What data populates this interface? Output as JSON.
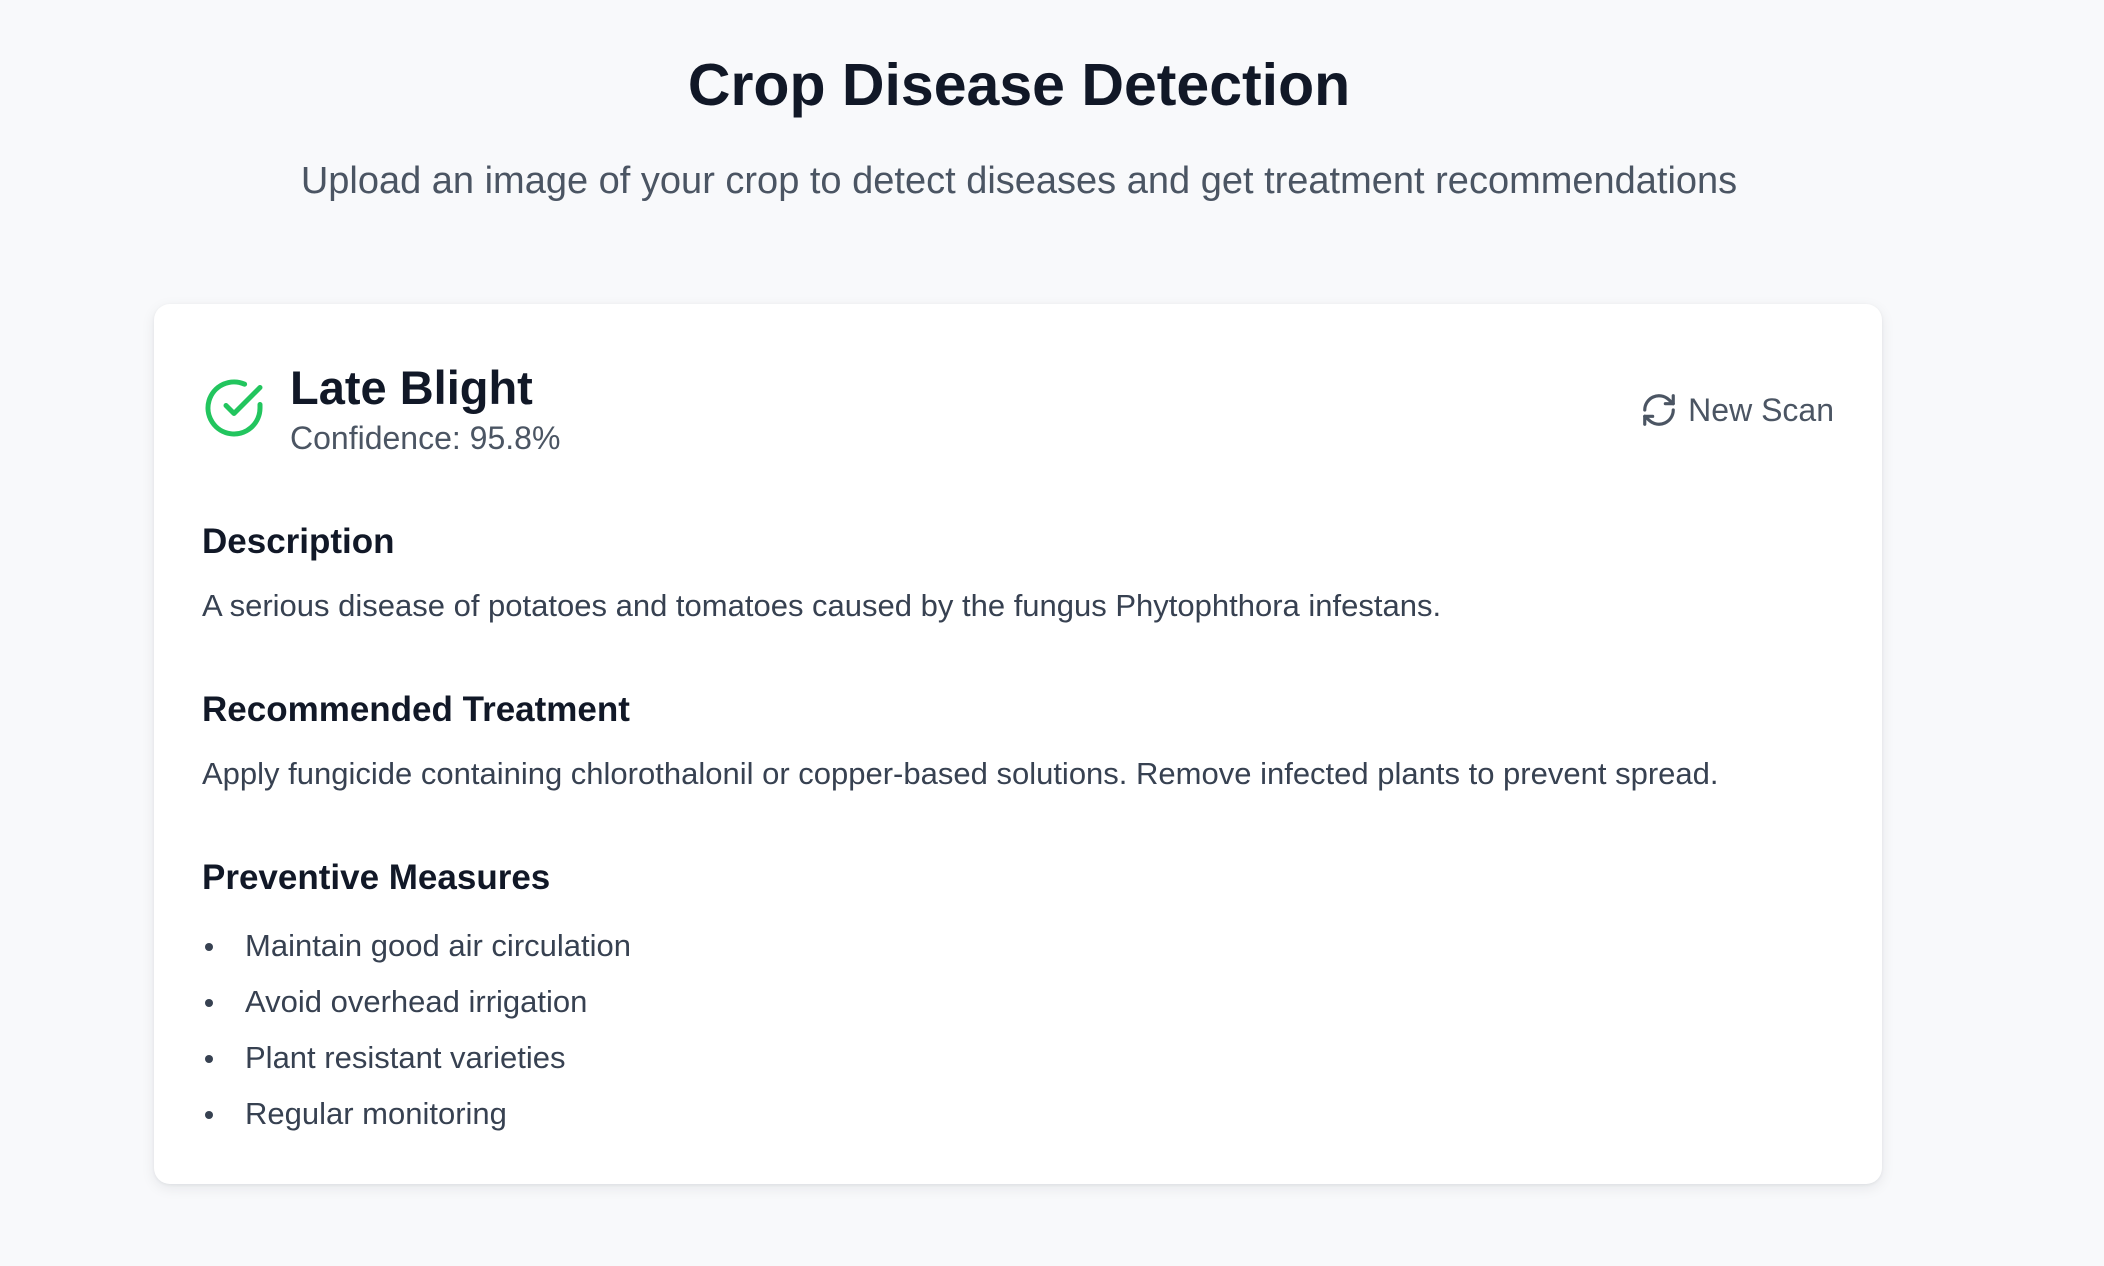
{
  "page": {
    "title": "Crop Disease Detection",
    "subtitle": "Upload an image of your crop to detect diseases and get treatment recommendations"
  },
  "result": {
    "disease_name": "Late Blight",
    "confidence": "Confidence: 95.8%",
    "status_icon": "check-circle-icon",
    "status_color": "#22c55e",
    "new_scan_label": "New Scan",
    "new_scan_icon": "refresh-icon"
  },
  "sections": {
    "description": {
      "title": "Description",
      "text": "A serious disease of potatoes and tomatoes caused by the fungus Phytophthora infestans."
    },
    "treatment": {
      "title": "Recommended Treatment",
      "text": "Apply fungicide containing chlorothalonil or copper-based solutions. Remove infected plants to prevent spread."
    },
    "prevention": {
      "title": "Preventive Measures",
      "items": [
        "Maintain good air circulation",
        "Avoid overhead irrigation",
        "Plant resistant varieties",
        "Regular monitoring"
      ]
    }
  }
}
